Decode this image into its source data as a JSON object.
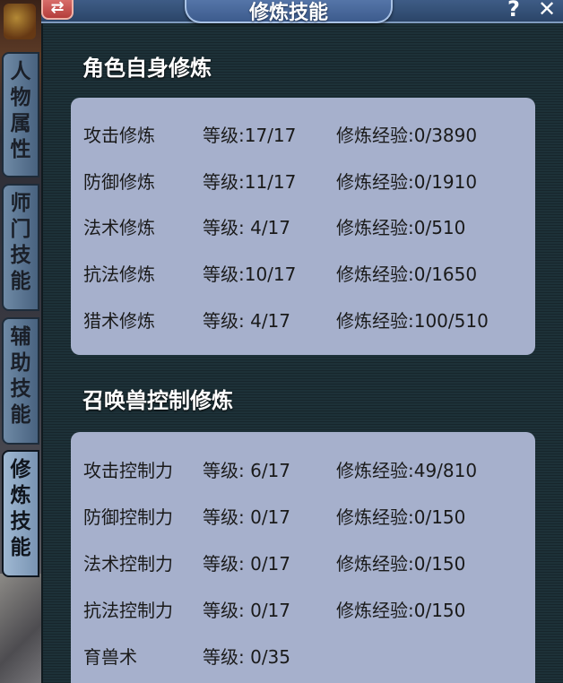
{
  "window": {
    "title": "修炼技能",
    "menu_icon": "swap-icon",
    "help_label": "?",
    "close_label": "✕"
  },
  "tabs": [
    {
      "label": [
        "人",
        "物",
        "属",
        "性"
      ],
      "active": false
    },
    {
      "label": [
        "师",
        "门",
        "技",
        "能"
      ],
      "active": false
    },
    {
      "label": [
        "辅",
        "助",
        "技",
        "能"
      ],
      "active": false
    },
    {
      "label": [
        "修",
        "炼",
        "技",
        "能"
      ],
      "active": true
    }
  ],
  "character_cultivation": {
    "heading": "角色自身修炼",
    "rows": [
      {
        "name": "攻击修炼",
        "level": "等级:17/17",
        "exp": "修炼经验:0/3890"
      },
      {
        "name": "防御修炼",
        "level": "等级:11/17",
        "exp": "修炼经验:0/1910"
      },
      {
        "name": "法术修炼",
        "level": "等级: 4/17",
        "exp": "修炼经验:0/510"
      },
      {
        "name": "抗法修炼",
        "level": "等级:10/17",
        "exp": "修炼经验:0/1650"
      },
      {
        "name": "猎术修炼",
        "level": "等级: 4/17",
        "exp": "修炼经验:100/510"
      }
    ]
  },
  "pet_control_cultivation": {
    "heading": "召唤兽控制修炼",
    "rows": [
      {
        "name": "攻击控制力",
        "level": "等级: 6/17",
        "exp": "修炼经验:49/810"
      },
      {
        "name": "防御控制力",
        "level": "等级: 0/17",
        "exp": "修炼经验:0/150"
      },
      {
        "name": "法术控制力",
        "level": "等级: 0/17",
        "exp": "修炼经验:0/150"
      },
      {
        "name": "抗法控制力",
        "level": "等级: 0/17",
        "exp": "修炼经验:0/150"
      },
      {
        "name": "育兽术",
        "level": "等级: 0/35",
        "exp": ""
      }
    ]
  }
}
